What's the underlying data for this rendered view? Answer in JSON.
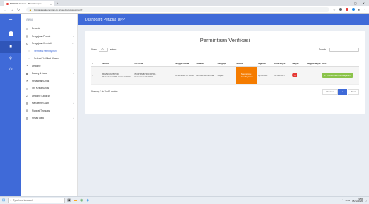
{
  "browser": {
    "tab_title": "BPRD Pelayanan - Balai Pengelo...",
    "url": "bprdjakarta.kemenpan.go.id/user/petugasupp/verify",
    "minimize": "—",
    "maximize": "▢",
    "close": "✕"
  },
  "sidebar": {
    "header": "Menu",
    "items": [
      {
        "label": "Beranda",
        "icon": "⌂",
        "name": "sidebar-item-beranda",
        "caret": ""
      },
      {
        "label": "Pengajuan Produk",
        "icon": "▤",
        "name": "sidebar-item-pengajuan-produk",
        "caret": "›"
      },
      {
        "label": "Pengajuan Kembali",
        "icon": "↻",
        "name": "sidebar-item-pengajuan-kembali",
        "caret": "⌄"
      },
      {
        "label": "Verifikasi Pembayaran",
        "icon": "○",
        "name": "sidebar-item-verifikasi-pembayaran",
        "caret": "",
        "sub": true,
        "active": true
      },
      {
        "label": "Selesai Verifikasi Ulasan",
        "icon": "○",
        "name": "sidebar-item-selesai-verifikasi",
        "caret": "",
        "sub": true
      },
      {
        "label": "Deadline",
        "icon": "◔",
        "name": "sidebar-item-deadline",
        "caret": ""
      },
      {
        "label": "Barang & Jasa",
        "icon": "▦",
        "name": "sidebar-item-barang-jasa",
        "caret": "›"
      },
      {
        "label": "Perjalanan Dinas",
        "icon": "✈",
        "name": "sidebar-item-perjalanan-dinas",
        "caret": ""
      },
      {
        "label": "Izin Keluar Dinas",
        "icon": "▭",
        "name": "sidebar-item-izin-keluar",
        "caret": ""
      },
      {
        "label": "Deadline Laporan",
        "icon": "☑",
        "name": "sidebar-item-deadline-laporan",
        "caret": ""
      },
      {
        "label": "Manajemen Aset",
        "icon": "▥",
        "name": "sidebar-item-manajemen-aset",
        "caret": "›"
      },
      {
        "label": "Riwayat Transaksi",
        "icon": "▤",
        "name": "sidebar-item-riwayat-transaksi",
        "caret": ""
      },
      {
        "label": "Rekap Data",
        "icon": "▧",
        "name": "sidebar-item-rekap-data",
        "caret": "›"
      }
    ]
  },
  "topbar": {
    "title": "Dashboard Petugas UPP"
  },
  "main": {
    "title": "Permintaan Verifikasi",
    "show_label": "Show",
    "entries_value": "10",
    "entries_label": "entries",
    "search_label": "Search:",
    "columns": [
      "#",
      "Nomor",
      "No Order",
      "Tanggal daftar",
      "Jabatan",
      "Pengaju",
      "Status",
      "Tagihan",
      "Kode Bayar",
      "Bayar",
      "Tanggal Bayar",
      "Aksi"
    ],
    "rows": [
      {
        "num": "1",
        "nomor": "B.0/BPRD/BPRD-Pelantikan/UPR-LAU/11/2020",
        "no_order": "B.0/PKN/BPRD/BPRD-Pelantikan/11/2020",
        "tanggal": "06-11-2020 07:38:49",
        "jabatan": "Dhimas Sumantha",
        "pengaju": "Buper",
        "status": "Menunggu Pembayaran",
        "tagihan": "Rp50.000",
        "kode_bayar": "787687987",
        "bayar": "×",
        "tanggal_bayar": "",
        "aksi": "Konfirmasi Pembayaran"
      }
    ],
    "info": "Showing 1 to 1 of 1 entries",
    "pager": {
      "previous": "Previous",
      "current": "1",
      "next": "Next"
    }
  },
  "taskbar": {
    "search_placeholder": "Type here to search",
    "time": "9:55",
    "date": "05/12/2020",
    "lang": "ENG"
  },
  "colors": {
    "accent": "#3f6ad8",
    "status": "#f57c00",
    "danger": "#e53935",
    "success": "#8bc34a"
  }
}
